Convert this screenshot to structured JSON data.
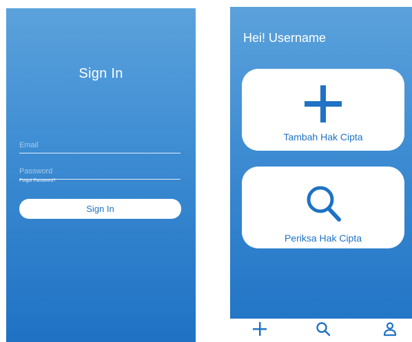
{
  "signin_screen": {
    "title": "Sign In",
    "email_placeholder": "Email",
    "password_placeholder": "Password",
    "forgot_password": "Forgot Password?",
    "signin_button": "Sign In"
  },
  "home_screen": {
    "greeting": "Hei! Username",
    "cards": [
      {
        "label": "Tambah Hak Cipta",
        "icon": "plus-icon"
      },
      {
        "label": "Periksa Hak Cipta",
        "icon": "search-icon"
      }
    ],
    "bottom_nav": [
      {
        "icon": "plus-icon"
      },
      {
        "icon": "search-icon"
      },
      {
        "icon": "user-icon"
      }
    ]
  },
  "colors": {
    "primary_blue": "#1f72c4",
    "gradient_top": "#5ba2dc",
    "gradient_bottom": "#1f72c4",
    "white": "#ffffff"
  }
}
